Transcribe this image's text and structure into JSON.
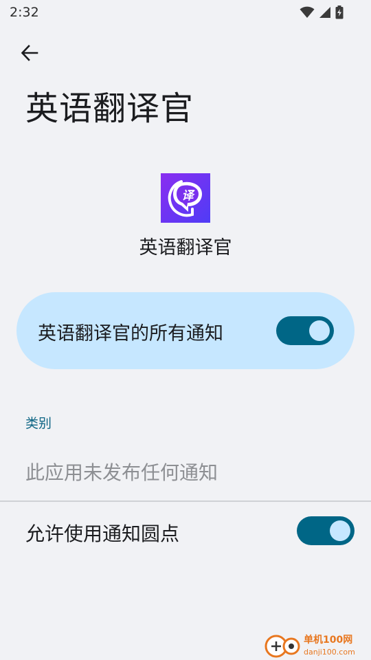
{
  "status_bar": {
    "time": "2:32",
    "icons": [
      "wifi-icon",
      "signal-icon",
      "battery-charging-icon"
    ]
  },
  "header": {
    "back_icon": "arrow-back-icon",
    "title": "英语翻译官"
  },
  "app": {
    "icon": "translate-app-icon",
    "icon_char": "译",
    "name": "英语翻译官"
  },
  "main_toggle": {
    "label": "英语翻译官的所有通知",
    "enabled": true
  },
  "categories": {
    "header": "类别",
    "empty_text": "此应用未发布任何通知"
  },
  "notification_dots": {
    "label": "允许使用通知圆点",
    "enabled": true
  },
  "watermark": {
    "brand": "单机100网",
    "domain": "danji100.com"
  },
  "colors": {
    "background": "#f1f2f5",
    "card": "#c6e7ff",
    "switch_track": "#006686",
    "accent_text": "#0d6584",
    "icon_gradient_start": "#7b2cf0",
    "icon_gradient_end": "#5a3cf5"
  }
}
